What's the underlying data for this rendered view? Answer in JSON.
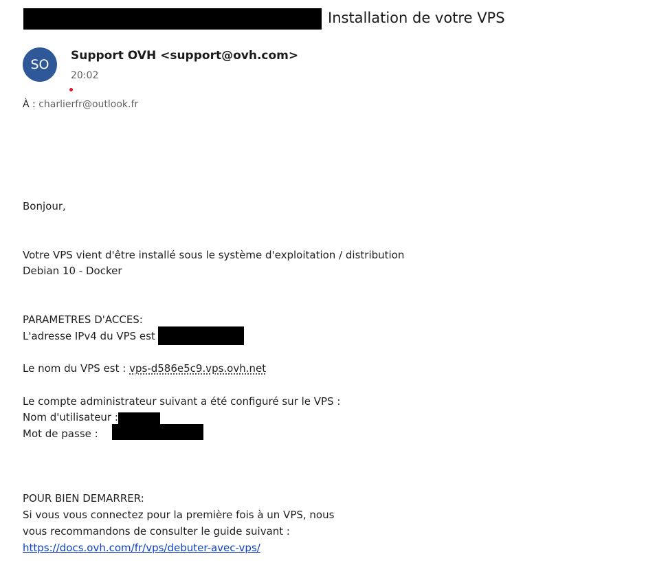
{
  "header": {
    "subject": "Installation de votre VPS"
  },
  "sender": {
    "initials": "SO",
    "name_line": "Support OVH <support@ovh.com>",
    "time": "20:02",
    "avatar_color": "#2e5897"
  },
  "recipient": {
    "label": "À :",
    "address": "charlierfr@outlook.fr"
  },
  "body": {
    "greeting": "Bonjour,",
    "intro_line1": "Votre VPS vient d'être installé sous le système d'exploitation / distribution",
    "intro_line2": "Debian 10 - Docker",
    "access_heading": "PARAMETRES D'ACCES:",
    "ipv4_label": "L'adresse IPv4 du VPS est :",
    "vps_name_label": "Le nom du VPS est :",
    "vps_name": "vps-d586e5c9.vps.ovh.net",
    "admin_line": "Le compte administrateur suivant a été configuré sur le VPS :",
    "username_label": "Nom d'utilisateur :",
    "password_label": "Mot de passe :",
    "start_heading": "POUR BIEN DEMARRER:",
    "start_line1": "Si vous vous connectez pour la première fois à un VPS, nous",
    "start_line2": "vous recommandons de consulter le guide suivant :",
    "guide_link": "https://docs.ovh.com/fr/vps/debuter-avec-vps/"
  },
  "colors": {
    "link": "#0b3ec3",
    "unread_dot": "#e8112d"
  }
}
